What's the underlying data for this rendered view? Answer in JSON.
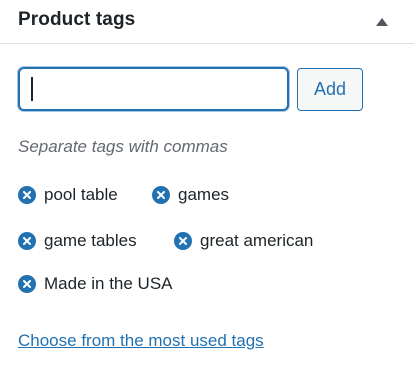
{
  "panel": {
    "title": "Product tags",
    "toggle_icon": "triangle-up-icon"
  },
  "tag_input": {
    "value": "",
    "placeholder": ""
  },
  "add_button_label": "Add",
  "hint": "Separate tags with commas",
  "tags": [
    {
      "label": "pool table"
    },
    {
      "label": "games"
    },
    {
      "label": "game tables"
    },
    {
      "label": "great american"
    },
    {
      "label": "Made in the USA"
    }
  ],
  "remove_icon": "remove-x-circle-icon",
  "most_used_link": "Choose from the most used tags",
  "colors": {
    "accent": "#2271b1",
    "text": "#1d2327",
    "hint": "#646970",
    "divider": "#e0e0e0"
  }
}
